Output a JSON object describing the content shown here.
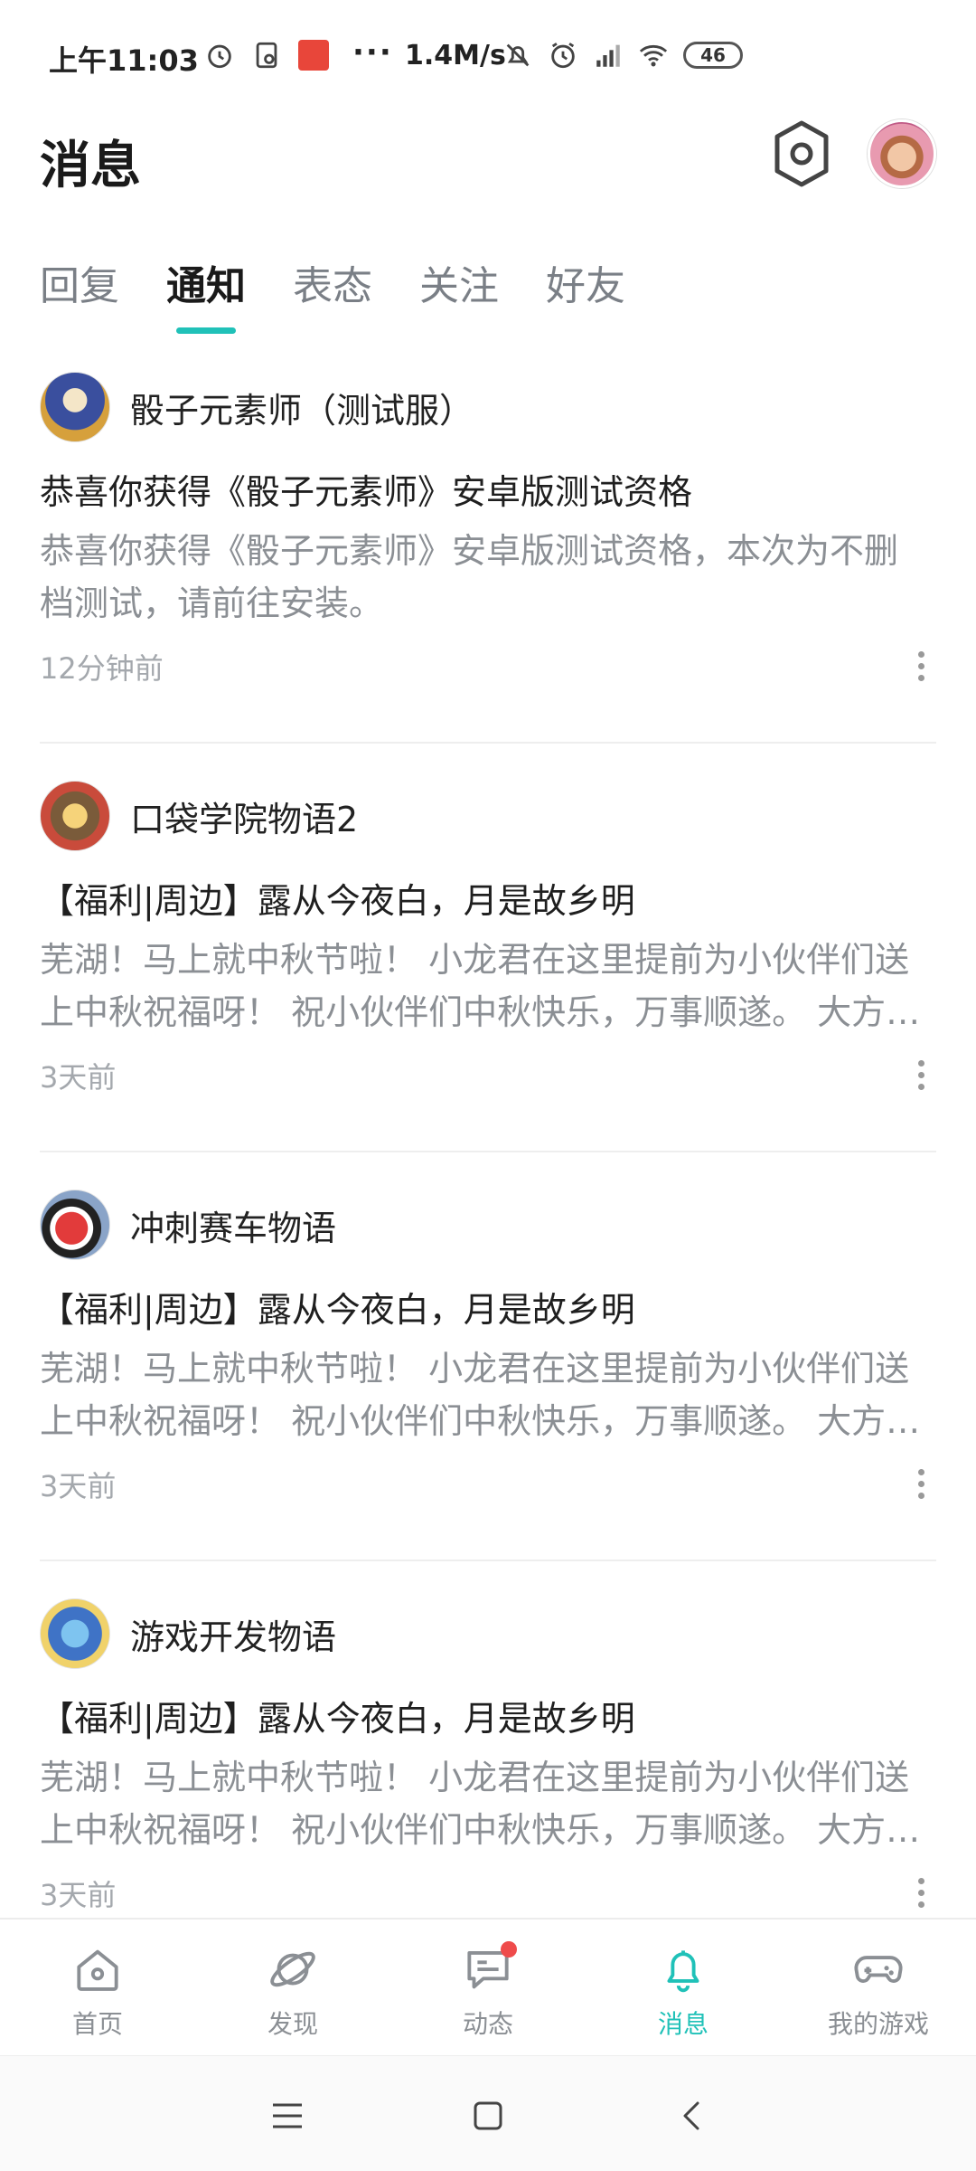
{
  "status_bar": {
    "time": "上午11:03",
    "dots": "···",
    "net_speed": "1.4M/s",
    "battery": "46"
  },
  "header": {
    "title": "消息"
  },
  "tabs": [
    {
      "label": "回复"
    },
    {
      "label": "通知"
    },
    {
      "label": "表态"
    },
    {
      "label": "关注"
    },
    {
      "label": "好友"
    }
  ],
  "active_tab": "通知",
  "messages": [
    {
      "game": "骰子元素师（测试服）",
      "title": "恭喜你获得《骰子元素师》安卓版测试资格",
      "body_lines": [
        "恭喜你获得《骰子元素师》安卓版测试资格，本次为不删",
        "档测试，请前往安装。"
      ],
      "time": "12分钟前"
    },
    {
      "game": "口袋学院物语2",
      "title": "【福利|周边】露从今夜白，月是故乡明",
      "body_lines": [
        "芜湖！马上就中秋节啦！ 小龙君在这里提前为小伙伴们送",
        "上中秋祝福呀！ 祝小伙伴们中秋快乐，万事顺遂。 大方…"
      ],
      "time": "3天前"
    },
    {
      "game": "冲刺赛车物语",
      "title": "【福利|周边】露从今夜白，月是故乡明",
      "body_lines": [
        "芜湖！马上就中秋节啦！ 小龙君在这里提前为小伙伴们送",
        "上中秋祝福呀！ 祝小伙伴们中秋快乐，万事顺遂。 大方…"
      ],
      "time": "3天前"
    },
    {
      "game": "游戏开发物语",
      "title": "【福利|周边】露从今夜白，月是故乡明",
      "body_lines": [
        "芜湖！马上就中秋节啦！ 小龙君在这里提前为小伙伴们送",
        "上中秋祝福呀！ 祝小伙伴们中秋快乐，万事顺遂。 大方…"
      ],
      "time": "3天前"
    }
  ],
  "bottom_nav": [
    {
      "label": "首页",
      "icon": "home-icon"
    },
    {
      "label": "发现",
      "icon": "planet-icon"
    },
    {
      "label": "动态",
      "icon": "chat-icon"
    },
    {
      "label": "消息",
      "icon": "bell-icon"
    },
    {
      "label": "我的游戏",
      "icon": "gamepad-icon"
    }
  ],
  "colors": {
    "accent": "#20c1b8",
    "badge": "#ef4b4b",
    "muted_text": "#8b8f94"
  }
}
